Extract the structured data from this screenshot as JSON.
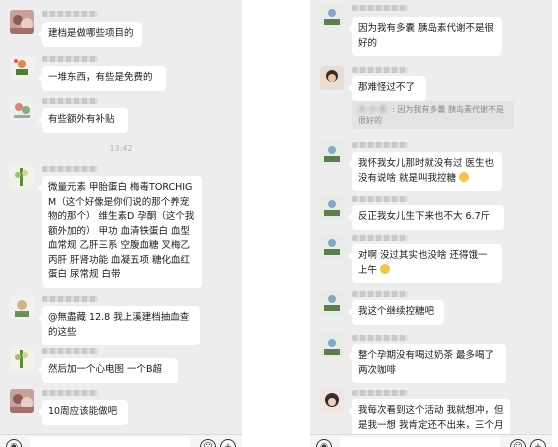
{
  "left_chat": {
    "time": "13:42",
    "messages": [
      {
        "text": "建档是做哪些项目的"
      },
      {
        "text": "一堆东西，有些是免费的"
      },
      {
        "text": "有些额外有补贴"
      },
      {
        "text": "微量元素 甲胎蛋白 梅毒TORCHIGM（这个好像是你们说的那个养宠物的那个） 维生素D 孕酮（这个我额外加的） 甲功 血清铁蛋白 血型 血常规 乙肝三系 空腹血糖 叉梅乙 丙肝 肝肾功能 血凝五项 糖化血红蛋白 尿常规 白带"
      },
      {
        "text": "@無盡藏 12.8 我上溪建档抽血查的这些"
      },
      {
        "text": "然后加一个心电图 一个B超"
      },
      {
        "text": "10周应该能做吧"
      }
    ]
  },
  "right_chat": {
    "messages": [
      {
        "text": "因为我有多囊 胰岛素代谢不是很好的"
      },
      {
        "text": "那难怪过不了"
      },
      {
        "quote": "因为我有多囊 胰岛素代谢不是很好的"
      },
      {
        "text": "我怀我女儿那时就没有过 医生也没有说啥 就是叫我控糖"
      },
      {
        "text": "反正我女儿生下来也不大 6.7斤"
      },
      {
        "text": "对啊 没过其实也没啥 还得饿一上午"
      },
      {
        "text": "我这个继续控糖吧"
      },
      {
        "text": "整个孕期没有喝过奶茶 最多喝了两次咖啡"
      },
      {
        "text": "我每次看到这个活动 我就想冲，但是我一想 我肯定还不出来，三个月"
      }
    ]
  },
  "icons": {
    "voice": "voice-icon",
    "emoji": "emoji-icon",
    "add": "add-icon"
  }
}
